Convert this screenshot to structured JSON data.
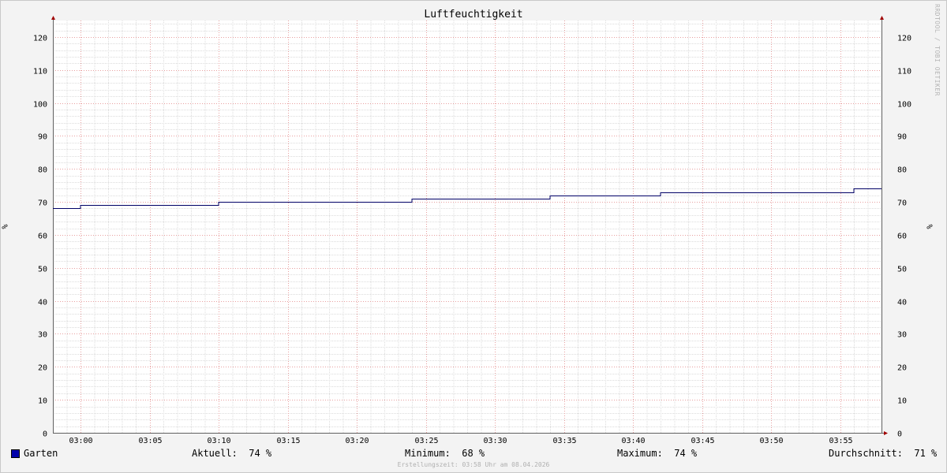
{
  "chart_data": {
    "type": "line",
    "title": "Luftfeuchtigkeit",
    "ylabel": "%",
    "ylim": [
      0,
      125
    ],
    "yticks": [
      0,
      10,
      20,
      30,
      40,
      50,
      60,
      70,
      80,
      90,
      100,
      110,
      120
    ],
    "xlim": [
      "02:58",
      "03:58"
    ],
    "xticks": [
      "03:00",
      "03:05",
      "03:10",
      "03:15",
      "03:20",
      "03:25",
      "03:30",
      "03:35",
      "03:40",
      "03:45",
      "03:50",
      "03:55"
    ],
    "grid": true,
    "series": [
      {
        "name": "Garten",
        "color": "#000066",
        "step": true,
        "points": [
          {
            "x": "02:58",
            "y": 68
          },
          {
            "x": "03:00",
            "y": 69
          },
          {
            "x": "03:10",
            "y": 70
          },
          {
            "x": "03:24",
            "y": 71
          },
          {
            "x": "03:34",
            "y": 72
          },
          {
            "x": "03:42",
            "y": 73
          },
          {
            "x": "03:56",
            "y": 74
          },
          {
            "x": "03:58",
            "y": 74
          }
        ]
      }
    ]
  },
  "legend": {
    "series_name": "Garten",
    "swatch_color": "#0000aa",
    "current": "Aktuell:  74 %",
    "minimum": "Minimum:  68 %",
    "maximum": "Maximum:  74 %",
    "average": "Durchschnitt:  71 %"
  },
  "footer": "Erstellungszeit: 03:58 Uhr am 08.04.2026",
  "watermark": "RRDTOOL / TOBI OETIKER",
  "colors": {
    "background": "#f3f3f3",
    "plot_background": "#ffffff",
    "major_grid": "#e8a0a0",
    "minor_grid": "#dcdcdc",
    "axis": "#606060",
    "arrow": "#a00000"
  }
}
